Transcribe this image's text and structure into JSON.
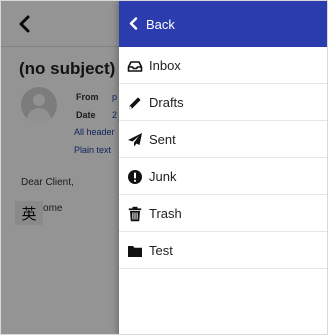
{
  "email": {
    "subject": "(no subject)",
    "from_label": "From",
    "from_value": "p",
    "date_label": "Date",
    "date_value": "2",
    "all_headers_link": "All header",
    "plain_text_link": "Plain text",
    "greeting": "Dear Client,",
    "welcome": "Welcome"
  },
  "ime_indicator": "英",
  "drawer": {
    "back_label": "Back",
    "header_color": "#2b3cae",
    "folders": [
      {
        "label": "Inbox",
        "icon": "inbox-icon"
      },
      {
        "label": "Drafts",
        "icon": "pencil-icon"
      },
      {
        "label": "Sent",
        "icon": "paper-plane-icon"
      },
      {
        "label": "Junk",
        "icon": "exclamation-circle-icon"
      },
      {
        "label": "Trash",
        "icon": "trash-icon"
      },
      {
        "label": "Test",
        "icon": "folder-icon"
      }
    ]
  }
}
